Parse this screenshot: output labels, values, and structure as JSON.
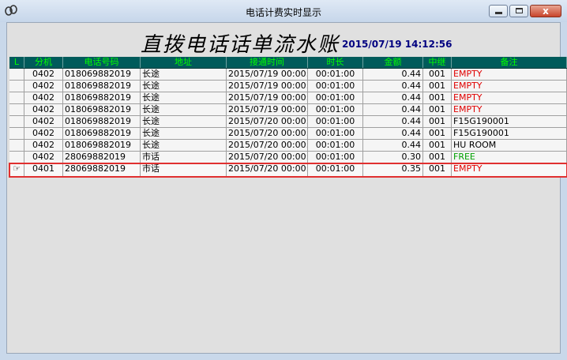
{
  "window": {
    "title": "电话计费实时显示",
    "min": "_",
    "max": "□",
    "close": "x"
  },
  "header": {
    "title": "直拨电话话单流水账",
    "timestamp": "2015/07/19 14:12:56"
  },
  "table": {
    "columns": [
      "L",
      "分机",
      "电话号码",
      "地址",
      "接通时间",
      "时长",
      "金额",
      "中继",
      "备注"
    ],
    "rows": [
      {
        "ext": "0402",
        "number": "018069882019",
        "location": "长途",
        "time": "2015/07/19 00:00:00",
        "duration": "00:01:00",
        "amount": "0.44",
        "trunk": "001",
        "note": "EMPTY",
        "note_color": "red"
      },
      {
        "ext": "0402",
        "number": "018069882019",
        "location": "长途",
        "time": "2015/07/19 00:00:00",
        "duration": "00:01:00",
        "amount": "0.44",
        "trunk": "001",
        "note": "EMPTY",
        "note_color": "red"
      },
      {
        "ext": "0402",
        "number": "018069882019",
        "location": "长途",
        "time": "2015/07/19 00:00:00",
        "duration": "00:01:00",
        "amount": "0.44",
        "trunk": "001",
        "note": "EMPTY",
        "note_color": "red"
      },
      {
        "ext": "0402",
        "number": "018069882019",
        "location": "长途",
        "time": "2015/07/19 00:00:00",
        "duration": "00:01:00",
        "amount": "0.44",
        "trunk": "001",
        "note": "EMPTY",
        "note_color": "red"
      },
      {
        "ext": "0402",
        "number": "018069882019",
        "location": "长途",
        "time": "2015/07/20 00:00:00",
        "duration": "00:01:00",
        "amount": "0.44",
        "trunk": "001",
        "note": "F15G190001",
        "note_color": "black"
      },
      {
        "ext": "0402",
        "number": "018069882019",
        "location": "长途",
        "time": "2015/07/20 00:00:00",
        "duration": "00:01:00",
        "amount": "0.44",
        "trunk": "001",
        "note": "F15G190001",
        "note_color": "black"
      },
      {
        "ext": "0402",
        "number": "018069882019",
        "location": "长途",
        "time": "2015/07/20 00:00:00",
        "duration": "00:01:00",
        "amount": "0.44",
        "trunk": "001",
        "note": "HU ROOM",
        "note_color": "black"
      },
      {
        "ext": "0402",
        "number": "28069882019",
        "location": "市话",
        "time": "2015/07/20 00:00:00",
        "duration": "00:01:00",
        "amount": "0.30",
        "trunk": "001",
        "note": "FREE",
        "note_color": "green"
      },
      {
        "ext": "0401",
        "number": "28069882019",
        "location": "市话",
        "time": "2015/07/20 00:00:00",
        "duration": "00:01:00",
        "amount": "0.35",
        "trunk": "001",
        "note": "EMPTY",
        "note_color": "red",
        "selected": true,
        "pointer": "☞"
      }
    ]
  },
  "colors": {
    "header_bg": "#005b5b",
    "header_text": "#00ff00",
    "selection": "#e03030"
  }
}
